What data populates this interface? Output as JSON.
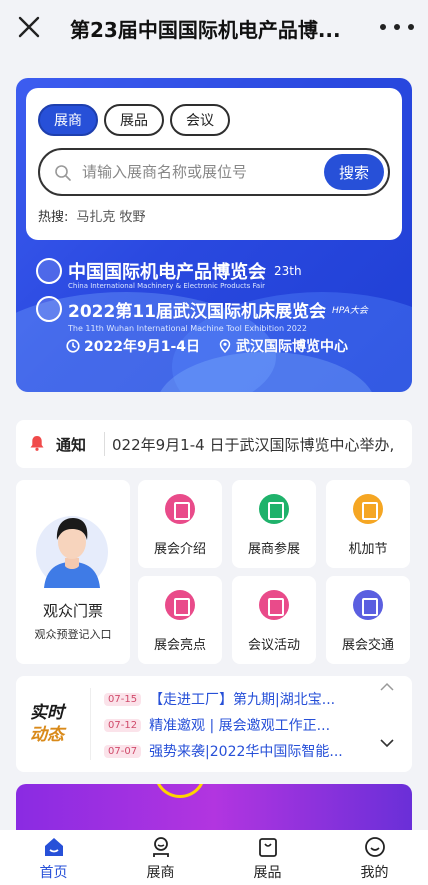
{
  "header": {
    "title": "第23届中国国际机电产品博...",
    "close_icon": "close-icon",
    "more_icon": "more-icon"
  },
  "search": {
    "tabs": [
      {
        "label": "展商",
        "active": true
      },
      {
        "label": "展品",
        "active": false
      },
      {
        "label": "会议",
        "active": false
      }
    ],
    "placeholder": "请输入展商名称或展位号",
    "button": "搜索",
    "hot_label": "热搜:",
    "hot_keywords": "马扎克  牧野"
  },
  "banner": {
    "line1_cn": "中国国际机电产品博览会",
    "line1_edition": "23th",
    "line1_en": "China International Machinery & Electronic Products Fair",
    "line2_cn": "2022第11届武汉国际机床展览会",
    "line2_tag": "HPA大会",
    "line2_en": "The 11th Wuhan International Machine Tool Exhibition 2022",
    "date": "2022年9月1-4日",
    "venue": "武汉国际博览中心"
  },
  "notice": {
    "label": "通知",
    "text": "022年9月1-4 日于武汉国际博览中心举办,"
  },
  "ticket": {
    "title": "观众门票",
    "subtitle": "观众预登记入口"
  },
  "grid": [
    {
      "label": "展会介绍",
      "color": "#e94b8a"
    },
    {
      "label": "展商参展",
      "color": "#1fb26b"
    },
    {
      "label": "机加节",
      "color": "#f5a623"
    },
    {
      "label": "展会亮点",
      "color": "#e94b8a"
    },
    {
      "label": "会议活动",
      "color": "#e94b8a"
    },
    {
      "label": "展会交通",
      "color": "#5b5fe0"
    }
  ],
  "news": {
    "label_line1": "实时",
    "label_line2": "动态",
    "items": [
      {
        "date": "07-15",
        "text": "【走进工厂】第九期|湖北宝..."
      },
      {
        "date": "07-12",
        "text": "精准邀观 | 展会邀观工作正..."
      },
      {
        "date": "07-07",
        "text": "强势来袭|2022华中国际智能..."
      }
    ]
  },
  "nav": [
    {
      "label": "首页",
      "icon": "home-icon",
      "active": true
    },
    {
      "label": "展商",
      "icon": "exhibitor-icon",
      "active": false
    },
    {
      "label": "展品",
      "icon": "product-bag-icon",
      "active": false
    },
    {
      "label": "我的",
      "icon": "profile-icon",
      "active": false
    }
  ],
  "colors": {
    "accent": "#2750d8",
    "banner": "#2a49e0",
    "news_date": "#d04b6b"
  }
}
